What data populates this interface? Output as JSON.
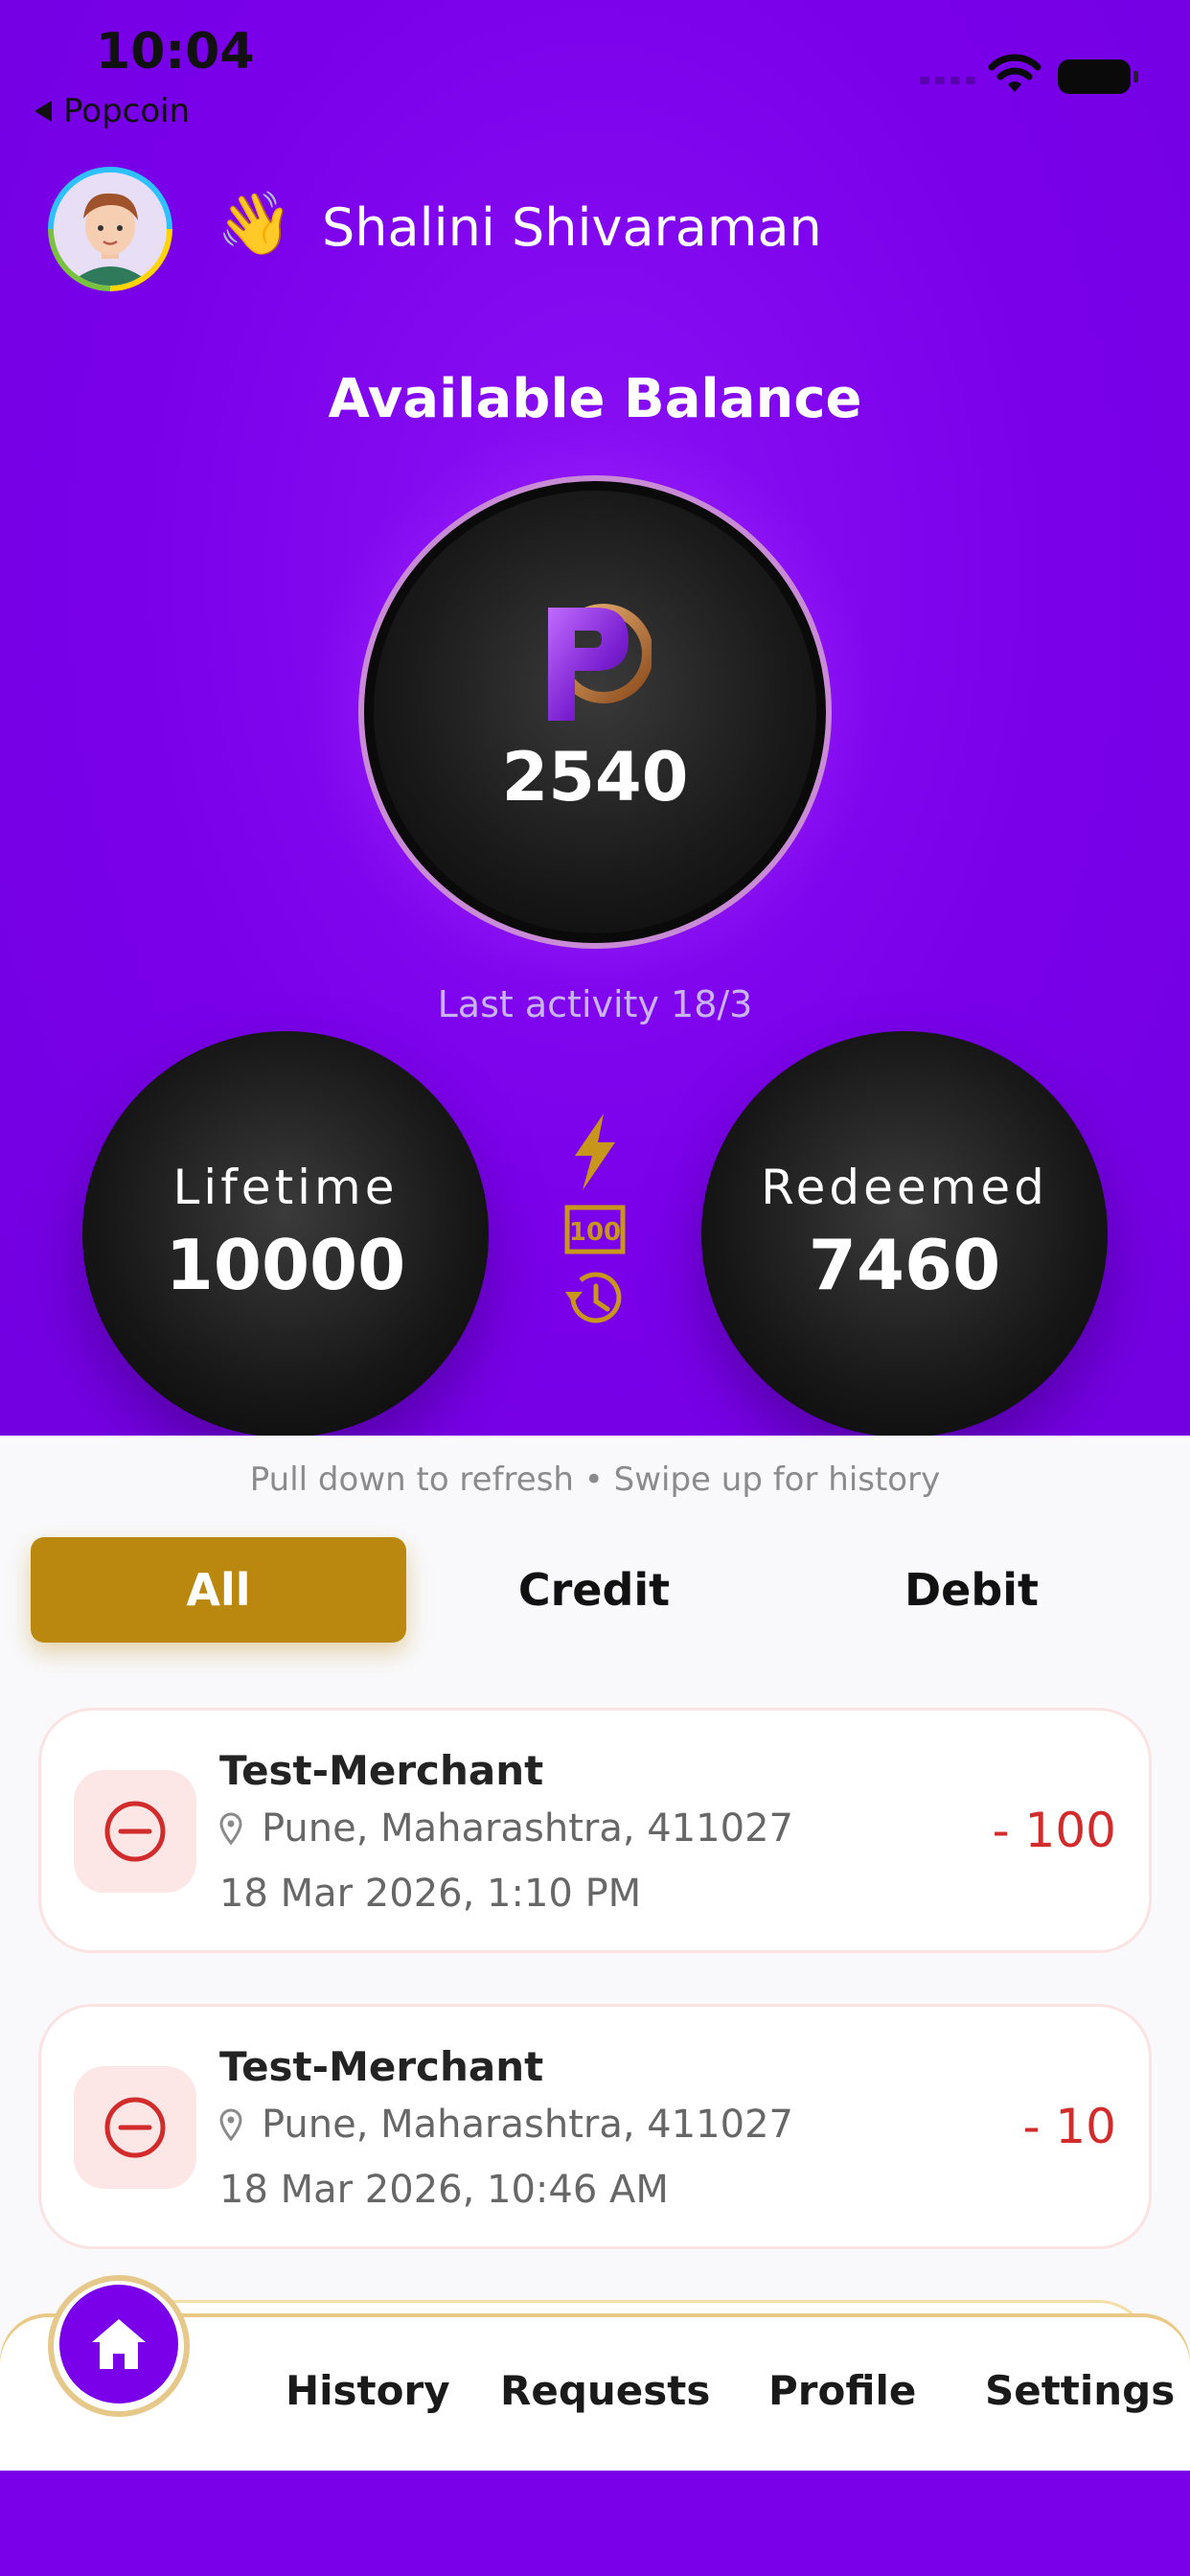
{
  "status_bar": {
    "time": "10:04",
    "back_label": "Popcoin"
  },
  "user": {
    "greeting_emoji": "👋",
    "name": "Shalini Shivaraman"
  },
  "balance": {
    "title": "Available Balance",
    "amount": "2540",
    "last_activity": "Last activity 18/3"
  },
  "stats": {
    "lifetime": {
      "label": "Lifetime",
      "value": "10000"
    },
    "redeemed": {
      "label": "Redeemed",
      "value": "7460"
    }
  },
  "hint": "Pull down to refresh • Swipe up for history",
  "filter_tabs": {
    "all": "All",
    "credit": "Credit",
    "debit": "Debit",
    "selected": "All"
  },
  "transactions": [
    {
      "merchant": "Test-Merchant",
      "location": "Pune, Maharashtra, 411027",
      "datetime": "18 Mar 2026, 1:10 PM",
      "amount": "- 100"
    },
    {
      "merchant": "Test-Merchant",
      "location": "Pune, Maharashtra, 411027",
      "datetime": "18 Mar 2026, 10:46 AM",
      "amount": "- 10"
    }
  ],
  "nav": {
    "history": "History",
    "requests": "Requests",
    "profile": "Profile",
    "settings": "Settings"
  },
  "colors": {
    "primary": "#7a00ea",
    "gold": "#bb880f",
    "debit": "#d12b2b"
  },
  "icons": {
    "home": "home-icon",
    "debit": "minus-circle-icon",
    "location": "location-pin-icon"
  }
}
